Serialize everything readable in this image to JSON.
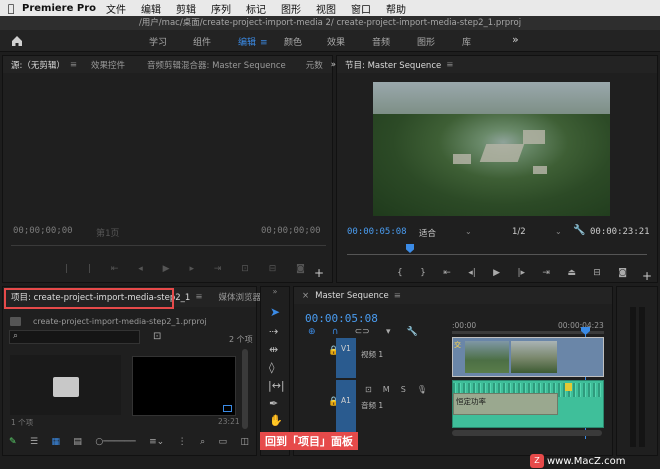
{
  "menubar": {
    "app_name": "Premiere Pro",
    "items": [
      "文件",
      "编辑",
      "剪辑",
      "序列",
      "标记",
      "图形",
      "视图",
      "窗口",
      "帮助"
    ]
  },
  "title": "/用户/mac/桌面/create-project-import-media 2/ create-project-import-media-step2_1.prproj",
  "workspace": {
    "tabs": [
      "学习",
      "组件",
      "编辑",
      "颜色",
      "效果",
      "音频",
      "图形",
      "库"
    ],
    "active": "编辑",
    "more": "»"
  },
  "source_panel": {
    "tabs": [
      "源:（无剪辑）",
      "效果控件",
      "音频剪辑混合器: Master Sequence",
      "元数"
    ],
    "timecode_left": "00;00;00;00",
    "timecode_right": "00;00;00;00",
    "page_indicator": "第1页"
  },
  "program_panel": {
    "tab": "节目: Master Sequence",
    "timecode": "00:00:05:08",
    "fit": "适合",
    "resolution": "1/2",
    "duration": "00:00:23:21"
  },
  "project_panel": {
    "tab_active": "项目: create-project-import-media-step2_1",
    "tab_other": "媒体浏览器",
    "path": "create-project-import-media-step2_1.prproj",
    "count": "2 个项",
    "item_left_name": "",
    "item_left_count": "1 个项",
    "item_right_duration": "23:21"
  },
  "timeline_panel": {
    "tab": "Master Sequence",
    "timecode": "00:00:05:08",
    "ruler_start": ":00:00",
    "ruler_mark": "00:00:04:23",
    "tracks": [
      {
        "id": "V1",
        "name": "视频 1"
      },
      {
        "id": "A1",
        "name": "音频 1"
      }
    ],
    "clip_label_audio": "恒定功率",
    "clip_label_video": "交"
  },
  "annotation": "回到「项目」面板",
  "watermark": "www.MacZ.com",
  "colors": {
    "accent": "#3b8be6",
    "highlight": "#e64a4a",
    "video_track": "#2a5b8f",
    "audio_clip": "#3fbf9a"
  }
}
